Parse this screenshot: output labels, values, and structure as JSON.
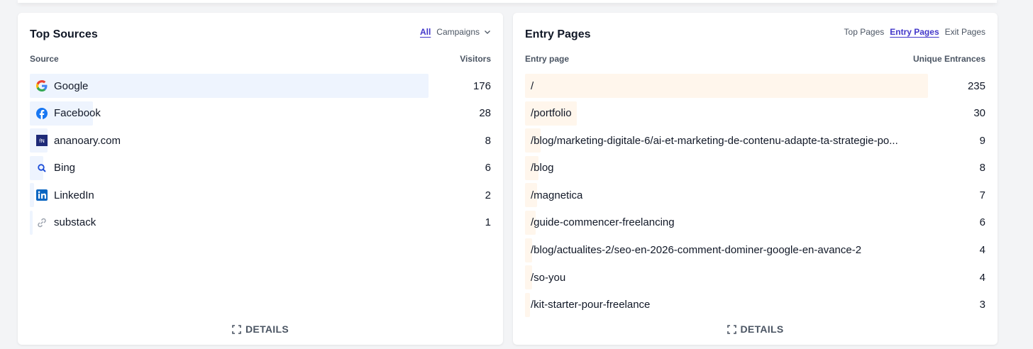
{
  "sources": {
    "title": "Top Sources",
    "tabs": [
      {
        "label": "All",
        "active": true
      },
      {
        "label": "Campaigns",
        "active": false,
        "icon": "chevron-down-icon"
      }
    ],
    "col_left": "Source",
    "col_right": "Visitors",
    "bar_color": "#eef4fe",
    "rows": [
      {
        "label": "Google",
        "value": "176",
        "icon": "google-icon",
        "share": 1.0
      },
      {
        "label": "Facebook",
        "value": "28",
        "icon": "facebook-icon",
        "share": 0.159
      },
      {
        "label": "ananoary.com",
        "value": "8",
        "icon": "ananoary-favicon-icon",
        "share": 0.045
      },
      {
        "label": "Bing",
        "value": "6",
        "icon": "bing-search-icon",
        "share": 0.034
      },
      {
        "label": "LinkedIn",
        "value": "2",
        "icon": "linkedin-icon",
        "share": 0.011
      },
      {
        "label": "substack",
        "value": "1",
        "icon": "link-icon",
        "share": 0.006
      }
    ],
    "details_label": "DETAILS"
  },
  "entry": {
    "title": "Entry Pages",
    "tabs": [
      {
        "label": "Top Pages",
        "active": false
      },
      {
        "label": "Entry Pages",
        "active": true
      },
      {
        "label": "Exit Pages",
        "active": false
      }
    ],
    "col_left": "Entry page",
    "col_right": "Unique Entrances",
    "bar_color": "#fff6ec",
    "rows": [
      {
        "label": "/",
        "value": "235",
        "share": 1.0
      },
      {
        "label": "/portfolio",
        "value": "30",
        "share": 0.128
      },
      {
        "label": "/blog/marketing-digitale-6/ai-et-marketing-de-contenu-adapte-ta-strategie-po...",
        "value": "9",
        "share": 0.038
      },
      {
        "label": "/blog",
        "value": "8",
        "share": 0.034
      },
      {
        "label": "/magnetica",
        "value": "7",
        "share": 0.03
      },
      {
        "label": "/guide-commencer-freelancing",
        "value": "6",
        "share": 0.026
      },
      {
        "label": "/blog/actualites-2/seo-en-2026-comment-dominer-google-en-avance-2",
        "value": "4",
        "share": 0.017
      },
      {
        "label": "/so-you",
        "value": "4",
        "share": 0.017
      },
      {
        "label": "/kit-starter-pour-freelance",
        "value": "3",
        "share": 0.013
      }
    ],
    "details_label": "DETAILS"
  }
}
